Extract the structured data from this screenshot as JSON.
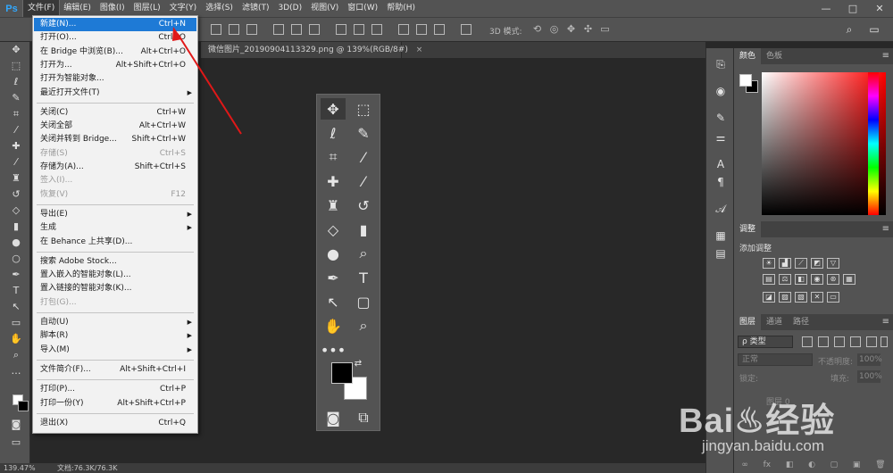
{
  "app": {
    "logo": "Ps"
  },
  "menubar": {
    "items": [
      "文件(F)",
      "编辑(E)",
      "图像(I)",
      "图层(L)",
      "文字(Y)",
      "选择(S)",
      "滤镜(T)",
      "3D(D)",
      "视图(V)",
      "窗口(W)",
      "帮助(H)"
    ],
    "active_index": 0
  },
  "window_controls": {
    "minimize": "—",
    "maximize": "□",
    "close": "✕"
  },
  "options_bar": {
    "label_3d": "3D 模式:"
  },
  "document": {
    "tab_title": "微信图片_20190904113329.png @ 139%(RGB/8#)",
    "close": "×"
  },
  "file_menu": {
    "items": [
      {
        "label": "新建(N)...",
        "shortcut": "Ctrl+N",
        "highlighted": true,
        "disabled": false,
        "submenu": false
      },
      {
        "label": "打开(O)...",
        "shortcut": "Ctrl+O",
        "disabled": false,
        "submenu": false
      },
      {
        "label": "在 Bridge 中浏览(B)...",
        "shortcut": "Alt+Ctrl+O",
        "disabled": false,
        "submenu": false
      },
      {
        "label": "打开为...",
        "shortcut": "Alt+Shift+Ctrl+O",
        "disabled": false,
        "submenu": false
      },
      {
        "label": "打开为智能对象...",
        "shortcut": "",
        "disabled": false,
        "submenu": false
      },
      {
        "label": "最近打开文件(T)",
        "shortcut": "",
        "disabled": false,
        "submenu": true
      },
      {
        "label": "关闭(C)",
        "shortcut": "Ctrl+W",
        "disabled": false,
        "submenu": false
      },
      {
        "label": "关闭全部",
        "shortcut": "Alt+Ctrl+W",
        "disabled": false,
        "submenu": false
      },
      {
        "label": "关闭并转到 Bridge...",
        "shortcut": "Shift+Ctrl+W",
        "disabled": false,
        "submenu": false
      },
      {
        "label": "存储(S)",
        "shortcut": "Ctrl+S",
        "disabled": true,
        "submenu": false
      },
      {
        "label": "存储为(A)...",
        "shortcut": "Shift+Ctrl+S",
        "disabled": false,
        "submenu": false
      },
      {
        "label": "签入(I)...",
        "shortcut": "",
        "disabled": true,
        "submenu": false
      },
      {
        "label": "恢复(V)",
        "shortcut": "F12",
        "disabled": true,
        "submenu": false
      },
      {
        "label": "导出(E)",
        "shortcut": "",
        "disabled": false,
        "submenu": true
      },
      {
        "label": "生成",
        "shortcut": "",
        "disabled": false,
        "submenu": true
      },
      {
        "label": "在 Behance 上共享(D)...",
        "shortcut": "",
        "disabled": false,
        "submenu": false
      },
      {
        "label": "搜索 Adobe Stock...",
        "shortcut": "",
        "disabled": false,
        "submenu": false
      },
      {
        "label": "置入嵌入的智能对象(L)...",
        "shortcut": "",
        "disabled": false,
        "submenu": false
      },
      {
        "label": "置入链接的智能对象(K)...",
        "shortcut": "",
        "disabled": false,
        "submenu": false
      },
      {
        "label": "打包(G)...",
        "shortcut": "",
        "disabled": true,
        "submenu": false
      },
      {
        "label": "自动(U)",
        "shortcut": "",
        "disabled": false,
        "submenu": true
      },
      {
        "label": "脚本(R)",
        "shortcut": "",
        "disabled": false,
        "submenu": true
      },
      {
        "label": "导入(M)",
        "shortcut": "",
        "disabled": false,
        "submenu": true
      },
      {
        "label": "文件简介(F)...",
        "shortcut": "Alt+Shift+Ctrl+I",
        "disabled": false,
        "submenu": false
      },
      {
        "label": "打印(P)...",
        "shortcut": "Ctrl+P",
        "disabled": false,
        "submenu": false
      },
      {
        "label": "打印一份(Y)",
        "shortcut": "Alt+Shift+Ctrl+P",
        "disabled": false,
        "submenu": false
      },
      {
        "label": "退出(X)",
        "shortcut": "Ctrl+Q",
        "disabled": false,
        "submenu": false
      }
    ]
  },
  "color_panel": {
    "tabs": [
      "颜色",
      "色板"
    ],
    "fg_color": "#ffffff",
    "bg_color": "#000000"
  },
  "adjustments_panel": {
    "tab": "调整",
    "add_label": "添加调整"
  },
  "layers_panel": {
    "tabs": [
      "图层",
      "通道",
      "路径"
    ],
    "filter_label": "ρ 类型",
    "blend_mode": "正常",
    "opacity_label": "不透明度:",
    "opacity_value": "100%",
    "lock_label": "锁定:",
    "fill_label": "填充:",
    "fill_value": "100%",
    "layer_name": "图层 0",
    "bottom_icons": [
      "∞",
      "fx",
      "◧",
      "◐",
      "▢",
      "▣",
      "🗑"
    ]
  },
  "statusbar": {
    "zoom": "139.47%",
    "doc_info": "文档:76.3K/76.3K"
  },
  "watermark": {
    "brand": "Bai♨经验",
    "url": "jingyan.baidu.com"
  },
  "colors": {
    "accent": "#1e7ad6",
    "annotation": "#e01818",
    "ps_blue": "#31a8ff"
  }
}
